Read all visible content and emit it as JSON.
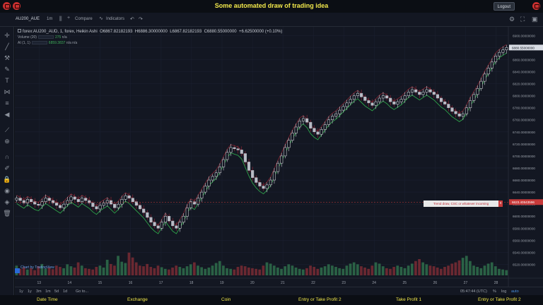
{
  "header": {
    "title": "Some automated draw of trading idea",
    "logout_label": "Logout"
  },
  "toolbar": {
    "symbol": "AU200_AUE",
    "interval": "1m",
    "compare_label": "Compare",
    "indicators_label": "Indicators"
  },
  "legend": {
    "series": "forex:AU200_AUD, 1, forex, Heikin Ashi",
    "open": "O6867.82182193",
    "high": "H6886.30000000",
    "low": "L6867.82182193",
    "close": "C6880.55000000",
    "change": "+6.62500000 (+0.10%)",
    "volume_label": "Volume (20)",
    "volume_value": "275",
    "volume_na": "n/a",
    "ai_label": "AI (1, 1)",
    "ai_value": "6859.3837",
    "ai_na1": "n/a",
    "ai_na2": "n/a"
  },
  "watermark": "Chart by TradingView",
  "annotation": {
    "text": "Trend draw, CSC or whatever incoming",
    "close": "x",
    "price_tag": "6623.40543596"
  },
  "price_axis": [
    "6900.00000000",
    "6880.00000000",
    "6860.00000000",
    "6840.00000000",
    "6820.00000000",
    "6800.00000000",
    "6780.00000000",
    "6760.00000000",
    "6740.00000000",
    "6720.00000000",
    "6700.00000000",
    "6680.00000000",
    "6660.00000000",
    "6640.00000000",
    "6620.00000000",
    "6600.00000000",
    "6580.00000000",
    "6560.00000000",
    "6540.00000000",
    "6520.00000000"
  ],
  "time_axis": [
    "13",
    "14",
    "15",
    "16",
    "17",
    "18",
    "19",
    "20",
    "21",
    "22",
    "23",
    "24",
    "25",
    "26",
    "27",
    "28"
  ],
  "bottom": {
    "ranges": [
      "1y",
      "1y",
      "3m",
      "1m",
      "5d",
      "1d"
    ],
    "goto": "Go to...",
    "time": "05:47:44 (UTC)",
    "pct": "%",
    "log": "log",
    "auto": "auto"
  },
  "footer": {
    "items": [
      "Date Time",
      "Exchange",
      "Coin",
      "Entry or Take Profit 2",
      "Take Profit 1",
      "Entry or Take Profit 2"
    ]
  },
  "chart_data": {
    "type": "candlestick",
    "style": "Heikin Ashi",
    "ylim": [
      6510,
      6905
    ],
    "x_range": [
      12.2,
      28.4
    ],
    "closes": [
      6630,
      6626,
      6622,
      6628,
      6624,
      6620,
      6618,
      6624,
      6630,
      6626,
      6622,
      6618,
      6614,
      6620,
      6626,
      6632,
      6628,
      6624,
      6630,
      6626,
      6622,
      6616,
      6612,
      6618,
      6622,
      6626,
      6620,
      6614,
      6620,
      6628,
      6634,
      6630,
      6624,
      6618,
      6612,
      6606,
      6598,
      6590,
      6584,
      6580,
      6590,
      6600,
      6592,
      6584,
      6580,
      6590,
      6600,
      6614,
      6624,
      6620,
      6630,
      6640,
      6650,
      6660,
      6666,
      6672,
      6682,
      6694,
      6706,
      6714,
      6712,
      6710,
      6704,
      6690,
      6676,
      6664,
      6656,
      6650,
      6646,
      6652,
      6660,
      6674,
      6688,
      6700,
      6714,
      6726,
      6738,
      6748,
      6758,
      6762,
      6756,
      6746,
      6740,
      6736,
      6744,
      6752,
      6760,
      6766,
      6770,
      6776,
      6782,
      6788,
      6794,
      6800,
      6804,
      6798,
      6792,
      6788,
      6784,
      6790,
      6796,
      6800,
      6796,
      6790,
      6786,
      6790,
      6794,
      6800,
      6806,
      6810,
      6806,
      6802,
      6806,
      6810,
      6806,
      6802,
      6796,
      6790,
      6786,
      6780,
      6774,
      6770,
      6766,
      6770,
      6780,
      6792,
      6802,
      6812,
      6824,
      6836,
      6846,
      6856,
      6866,
      6872,
      6876,
      6880
    ],
    "volume_ylim": [
      0,
      100
    ],
    "volumes": [
      30,
      20,
      25,
      18,
      22,
      16,
      28,
      35,
      20,
      24,
      19,
      30,
      26,
      22,
      34,
      28,
      24,
      40,
      30,
      22,
      20,
      18,
      26,
      30,
      24,
      48,
      35,
      30,
      60,
      42,
      38,
      70,
      55,
      40,
      30,
      28,
      35,
      26,
      22,
      30,
      25,
      20,
      18,
      24,
      30,
      26,
      22,
      28,
      34,
      40,
      30,
      25,
      20,
      24,
      30,
      38,
      44,
      30,
      22,
      20,
      18,
      26,
      30,
      28,
      24,
      22,
      20,
      18,
      30,
      40,
      36,
      30,
      24,
      20,
      28,
      34,
      30,
      24,
      20,
      18,
      22,
      30,
      26,
      20,
      24,
      28,
      34,
      30,
      26,
      22,
      20,
      30,
      36,
      40,
      34,
      28,
      24,
      20,
      30,
      40,
      36,
      28,
      22,
      20,
      26,
      30,
      26,
      22,
      30,
      36,
      44,
      50,
      40,
      34,
      30,
      28,
      24,
      20,
      26,
      30,
      36,
      40,
      46,
      54,
      60,
      44,
      30,
      26,
      22,
      30,
      36,
      40,
      28,
      20,
      18,
      16
    ]
  }
}
